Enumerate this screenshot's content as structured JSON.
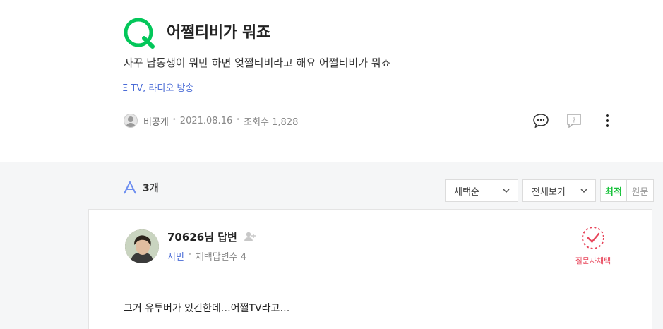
{
  "question": {
    "title": "어쩔티비가 뭐죠",
    "body": "자꾸 남동생이 뭐만 하면 엊쩔티비라고 해요 어쩔티비가 뭐죠",
    "category": "Ξ TV, 라디오 방송",
    "author": "비공개",
    "date": "2021.08.16",
    "views": "조회수 1,828",
    "logo_icon": "q-logo-icon",
    "brand_color": "#03c75a"
  },
  "answers": {
    "letter": "A",
    "count": "3개",
    "sort_label": "채택순",
    "filter_label": "전체보기",
    "toggle_on": "최적",
    "toggle_off": "원문"
  },
  "answer": {
    "name": "70626님 답변",
    "rank": "시민",
    "adopt_count": "채택답변수 4",
    "choose_label": "질문자채택",
    "text": "그거 유투버가 있긴한데…어쩔TV라고…",
    "accent_color": "#e8475c"
  }
}
